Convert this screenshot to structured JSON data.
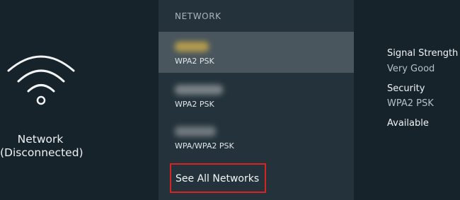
{
  "left": {
    "icon": "wifi-icon",
    "status_line1": "Network",
    "status_line2": "(Disconnected)"
  },
  "middle": {
    "section_title": "NETWORK",
    "networks": [
      {
        "name": "",
        "security": "WPA2 PSK",
        "focused": true,
        "name_color": "#c8a94a"
      },
      {
        "name": "",
        "security": "WPA2 PSK",
        "focused": false,
        "name_color": "#8a9196"
      },
      {
        "name": "",
        "security": "WPA/WPA2 PSK",
        "focused": false,
        "name_color": "#7e868b"
      }
    ],
    "see_all_label": "See All Networks"
  },
  "right": {
    "signal_label": "Signal Strength",
    "signal_value": "Very Good",
    "security_label": "Security",
    "security_value": "WPA2 PSK",
    "available_label": "Available"
  },
  "colors": {
    "highlight_border": "#d9231e",
    "focused_row": "#4a565d",
    "background": "#16232b"
  }
}
